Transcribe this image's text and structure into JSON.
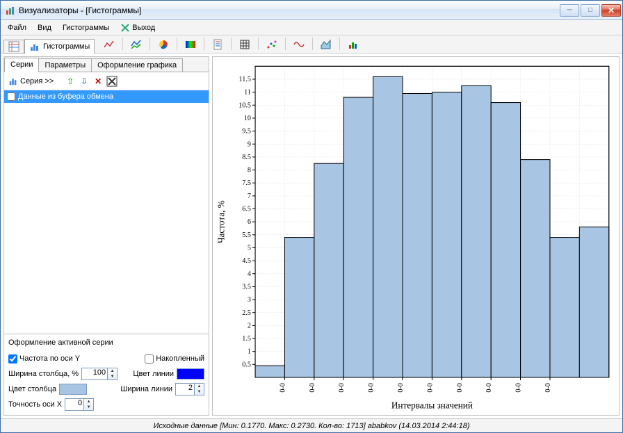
{
  "window": {
    "title": "Визуализаторы - [Гистограммы]"
  },
  "menu": {
    "file": "Файл",
    "view": "Вид",
    "histograms": "Гистограммы",
    "exit": "Выход"
  },
  "tabs": {
    "main_active": "Гистограммы"
  },
  "left": {
    "tab_series": "Серии",
    "tab_params": "Параметры",
    "tab_design": "Оформление графика",
    "series_btn": "Серия >>",
    "series_item": "Данные из буфера обмена",
    "form_title": "Оформление активной серии",
    "freq_y": "Частота по оси Y",
    "accumulated": "Накопленный",
    "bar_width": "Ширина столбца, %",
    "bar_width_val": "100",
    "bar_color": "Цвет столбца",
    "line_color": "Цвет линии",
    "line_width": "Ширина линии",
    "line_width_val": "2",
    "x_precision": "Точность оси X",
    "x_precision_val": "0",
    "colors": {
      "bar": "#a9c5e4",
      "line": "#0000ff"
    }
  },
  "chart_data": {
    "type": "bar",
    "ylabel": "Частота, %",
    "xlabel": "Интервалы значений",
    "categories": [
      "0-0",
      "0-0",
      "0-0",
      "0-0",
      "0-0",
      "0-0",
      "0-0",
      "0-0",
      "0-0",
      "0-0"
    ],
    "values": [
      0.45,
      5.4,
      8.25,
      10.8,
      11.6,
      10.95,
      11.0,
      11.25,
      10.6,
      8.4,
      5.4,
      5.8
    ],
    "ylim": [
      0,
      12
    ],
    "yticks": [
      0.5,
      1,
      1.5,
      2,
      2.5,
      3,
      3.5,
      4,
      4.5,
      5,
      5.5,
      6,
      6.5,
      7,
      7.5,
      8,
      8.5,
      9,
      9.5,
      10,
      10.5,
      11,
      11.5
    ]
  },
  "status": "Исходные данные [Мин: 0.1770. Макс: 0.2730. Кол-во: 1713] ababkov (14.03.2014 2:44:18)"
}
